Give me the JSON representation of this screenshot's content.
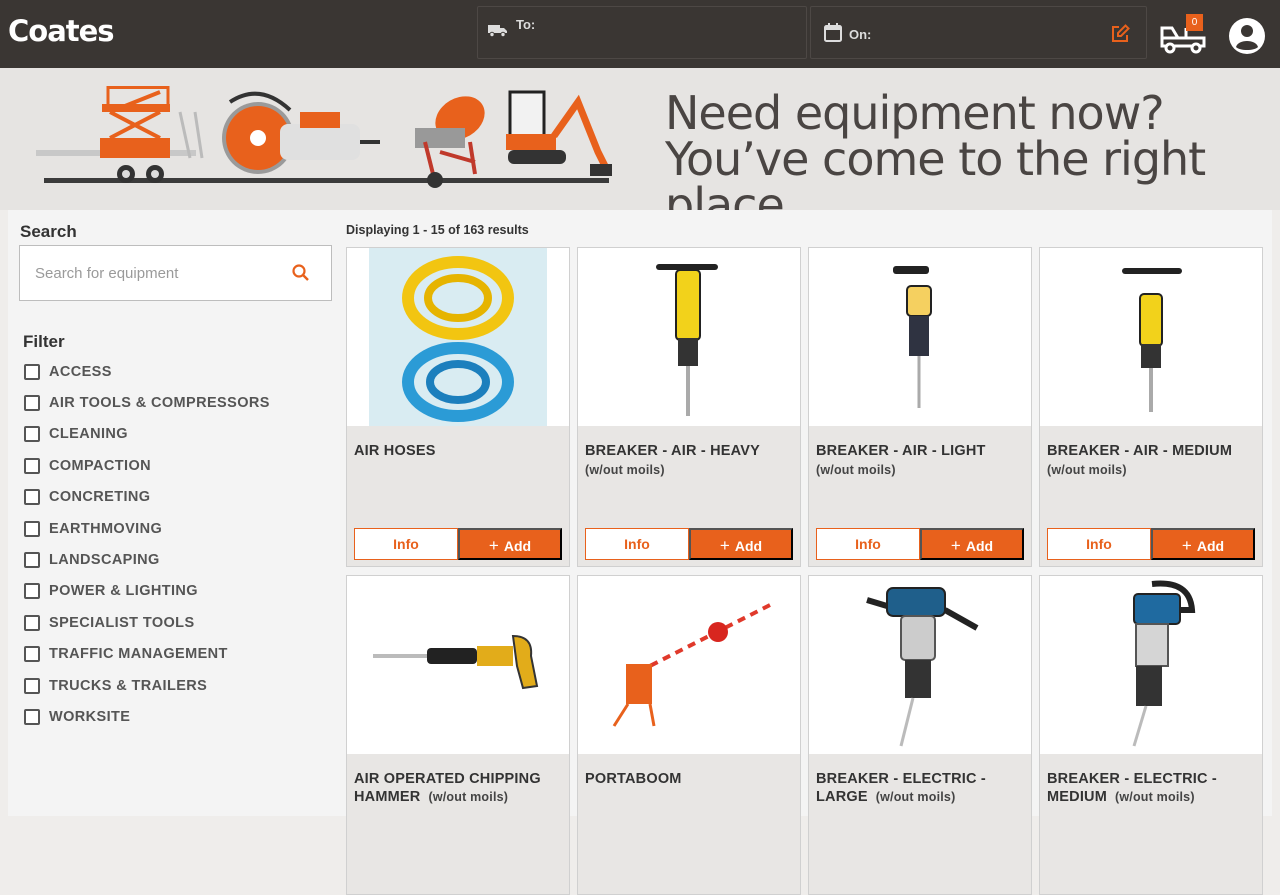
{
  "header": {
    "logo": "Coates",
    "to_label": "To:",
    "on_label": "On:",
    "cart_count": "0"
  },
  "banner": {
    "line1": "Need equipment now?",
    "line2": "You’ve come to the right place."
  },
  "sidebar": {
    "search_title": "Search",
    "search_placeholder": "Search for equipment",
    "filter_title": "Filter",
    "filters": [
      "ACCESS",
      "AIR TOOLS & COMPRESSORS",
      "CLEANING",
      "COMPACTION",
      "CONCRETING",
      "EARTHMOVING",
      "LANDSCAPING",
      "POWER & LIGHTING",
      "SPECIALIST TOOLS",
      "TRAFFIC MANAGEMENT",
      "TRUCKS & TRAILERS",
      "WORKSITE"
    ]
  },
  "results": {
    "count_text": "Displaying 1 - 15 of 163 results",
    "info_label": "Info",
    "add_label": "Add",
    "products": [
      {
        "title": "AIR HOSES",
        "sub": ""
      },
      {
        "title": "BREAKER - AIR - HEAVY",
        "sub": "(w/out moils)"
      },
      {
        "title": "BREAKER - AIR - LIGHT",
        "sub": "(w/out moils)"
      },
      {
        "title": "BREAKER - AIR - MEDIUM",
        "sub": "(w/out moils)"
      },
      {
        "title": "AIR OPERATED CHIPPING HAMMER",
        "sub": "(w/out moils)"
      },
      {
        "title": "PORTABOOM",
        "sub": ""
      },
      {
        "title": "BREAKER - ELECTRIC - LARGE",
        "sub": "(w/out moils)"
      },
      {
        "title": "BREAKER - ELECTRIC - MEDIUM",
        "sub": "(w/out moils)"
      }
    ]
  },
  "colors": {
    "header_bg": "#3a3633",
    "accent": "#e8611c",
    "banner_bg": "#e6e4e2"
  },
  "icons": [
    "truck-icon",
    "calendar-icon",
    "edit-icon",
    "cart-truck-icon",
    "user-icon",
    "search-icon"
  ]
}
